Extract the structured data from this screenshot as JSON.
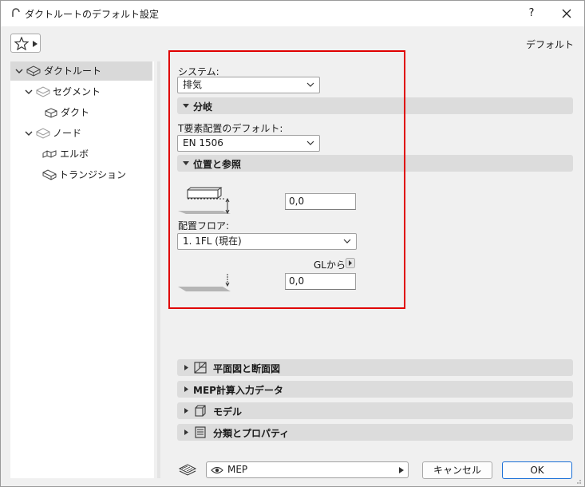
{
  "window": {
    "title": "ダクトルートのデフォルト設定",
    "help": "?",
    "default_label": "デフォルト"
  },
  "tree": {
    "items": [
      {
        "label": "ダクトルート",
        "icon": "duct-route-icon",
        "expanded": true,
        "selected": true
      },
      {
        "label": "セグメント",
        "icon": "segment-icon",
        "expanded": true
      },
      {
        "label": "ダクト",
        "icon": "duct-icon"
      },
      {
        "label": "ノード",
        "icon": "node-icon",
        "expanded": true
      },
      {
        "label": "エルボ",
        "icon": "elbow-icon"
      },
      {
        "label": "トランジション",
        "icon": "transition-icon"
      }
    ]
  },
  "panel": {
    "system_label": "システム:",
    "system_value": "排気",
    "branch_section": "分岐",
    "t_element_label": "T要素配置のデフォルト:",
    "t_element_value": "EN 1506",
    "position_section": "位置と参照",
    "offset_value": "0,0",
    "floor_label": "配置フロア:",
    "floor_value": "1. 1FL (現在)",
    "gl_label": "GLから",
    "gl_value": "0,0"
  },
  "sections": [
    {
      "label": "平面図と断面図",
      "icon": "floor-plan-icon"
    },
    {
      "label": "MEP計算入力データ",
      "icon": ""
    },
    {
      "label": "モデル",
      "icon": "model-icon"
    },
    {
      "label": "分類とプロパティ",
      "icon": "classification-icon"
    }
  ],
  "footer": {
    "view_select": "MEP",
    "cancel": "キャンセル",
    "ok": "OK"
  },
  "colors": {
    "highlight_border": "#e00000",
    "ok_border": "#1a6fd6"
  }
}
